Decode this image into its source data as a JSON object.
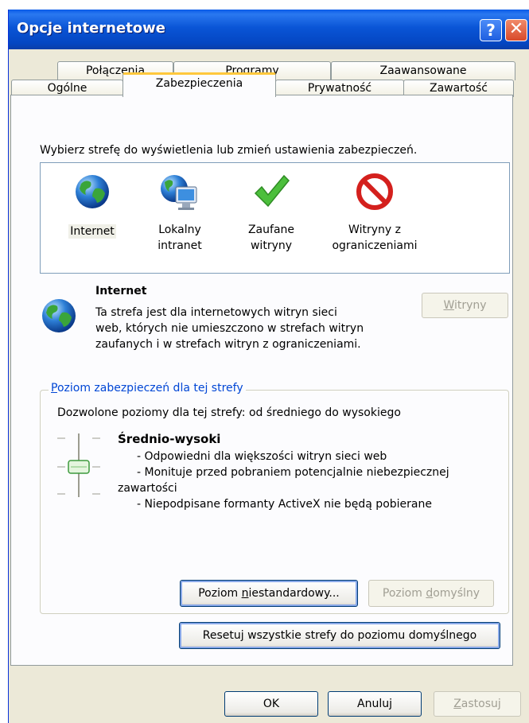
{
  "window": {
    "title": "Opcje internetowe"
  },
  "title_buttons": {
    "help": "?",
    "close": "✕"
  },
  "tabs": {
    "row1": [
      "Połączenia",
      "Programy",
      "Zaawansowane"
    ],
    "row2": [
      "Ogólne",
      "Zabezpieczenia",
      "Prywatność",
      "Zawartość"
    ],
    "active": "Zabezpieczenia"
  },
  "zones": {
    "prompt": "Wybierz strefę do wyświetlenia lub zmień ustawienia zabezpieczeń.",
    "items": [
      {
        "line1": "Internet",
        "line2": "",
        "icon": "globe-icon",
        "selected": true
      },
      {
        "line1": "Lokalny",
        "line2": "intranet",
        "icon": "computer-globe-icon",
        "selected": false
      },
      {
        "line1": "Zaufane",
        "line2": "witryny",
        "icon": "checkmark-icon",
        "selected": false
      },
      {
        "line1": "Witryny z",
        "line2": "ograniczeniami",
        "icon": "restricted-icon",
        "selected": false
      }
    ]
  },
  "zone_info": {
    "title": "Internet",
    "desc_lines": [
      "Ta strefa jest dla internetowych witryn sieci",
      "web, których nie umieszczono w strefach witryn",
      "zaufanych i w strefach witryn z ograniczeniami."
    ],
    "sites_button": {
      "before": "",
      "accel": "W",
      "after": "itryny"
    }
  },
  "security_level": {
    "legend": {
      "accel": "P",
      "after": "oziom zabezpieczeń dla tej strefy"
    },
    "allowed": "Dozwolone poziomy dla tej strefy: od średniego do wysokiego",
    "level_name": "Średnio-wysoki",
    "details": [
      "- Odpowiedni dla większości witryn sieci web",
      "- Monituje przed pobraniem potencjalnie niebezpiecznej",
      "zawartości",
      "- Niepodpisane formanty ActiveX nie będą pobierane"
    ],
    "custom_button": {
      "before": "Poziom ",
      "accel": "n",
      "after": "iestandardowy..."
    },
    "default_button": {
      "before": "Poziom ",
      "accel": "d",
      "after": "omyślny"
    }
  },
  "reset_button": {
    "before": "Resetu",
    "accel": "j",
    "after": " wszystkie strefy do poziomu domyślnego"
  },
  "footer": {
    "ok": "OK",
    "cancel": "Anuluj",
    "apply": {
      "before": "",
      "accel": "Z",
      "after": "astosuj"
    }
  }
}
